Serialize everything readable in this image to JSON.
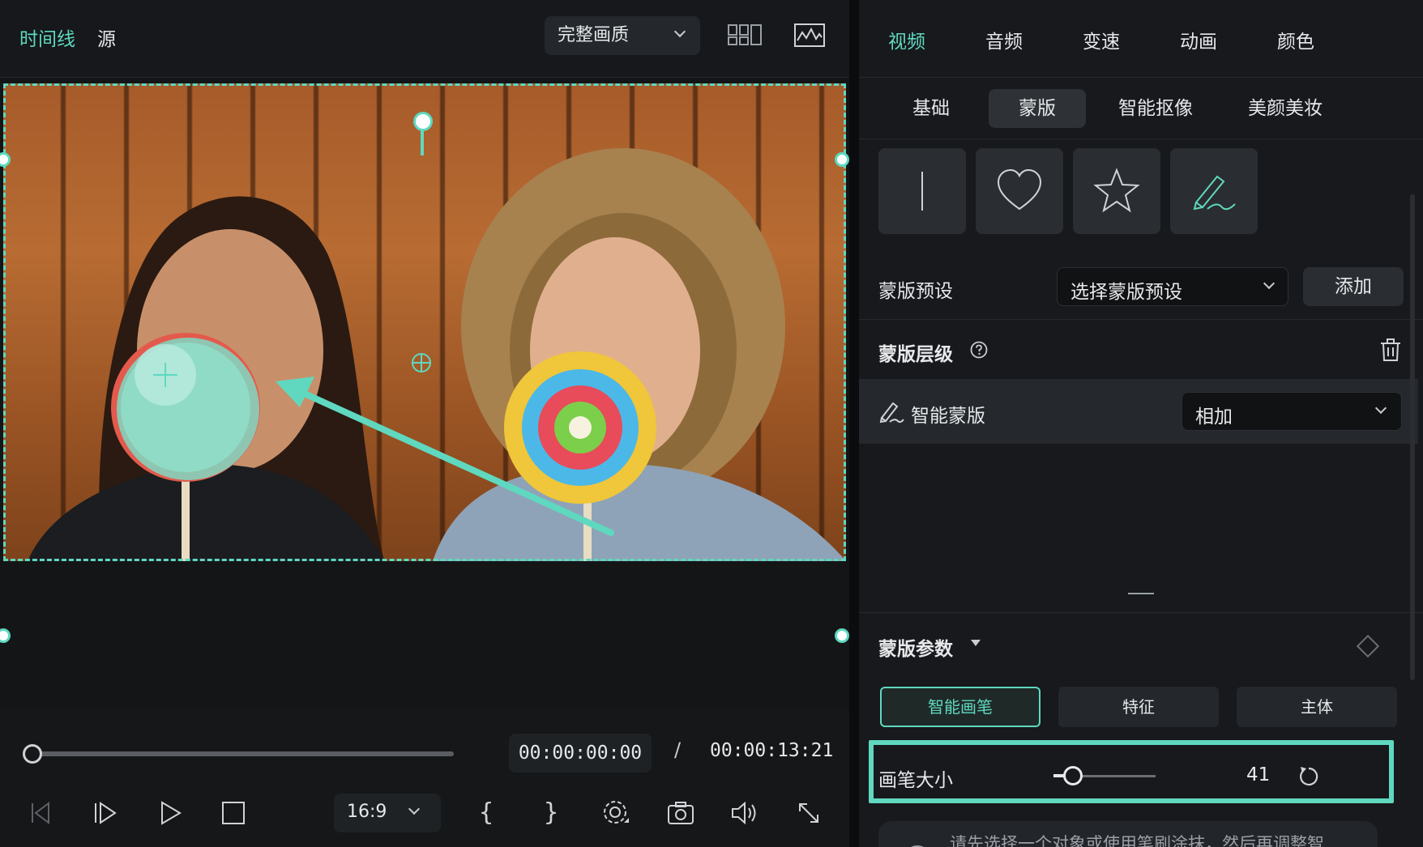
{
  "player": {
    "tabs": [
      {
        "label": "时间线",
        "active": true
      },
      {
        "label": "源",
        "active": false
      }
    ],
    "quality": {
      "label": "完整画质"
    },
    "current_time": "00:00:00:00",
    "separator": "/",
    "total_time": "00:00:13:21",
    "aspect_ratio": "16:9",
    "icons": [
      "grid-view-icon",
      "waveform-monitor-icon",
      "prev-frame-icon",
      "next-frame-icon",
      "play-icon",
      "stop-icon",
      "mark-in-icon",
      "mark-out-icon",
      "settings-icon",
      "snapshot-icon",
      "volume-icon",
      "fullscreen-icon"
    ]
  },
  "panel": {
    "top_tabs": [
      {
        "label": "视频",
        "active": true
      },
      {
        "label": "音频",
        "active": false
      },
      {
        "label": "变速",
        "active": false
      },
      {
        "label": "动画",
        "active": false
      },
      {
        "label": "颜色",
        "active": false
      }
    ],
    "sub_tabs": [
      {
        "label": "基础",
        "active": false
      },
      {
        "label": "蒙版",
        "active": true
      },
      {
        "label": "智能抠像",
        "active": false
      },
      {
        "label": "美颜美妆",
        "active": false
      }
    ],
    "mask_shapes": [
      "line-mask-icon",
      "heart-mask-icon",
      "star-mask-icon",
      "brush-mask-icon"
    ],
    "preset": {
      "label": "蒙版预设",
      "select_value": "选择蒙版预设",
      "add_label": "添加"
    },
    "layer": {
      "label": "蒙版层级",
      "item_label": "智能蒙版",
      "blend_value": "相加"
    },
    "params": {
      "label": "蒙版参数",
      "modes": [
        {
          "label": "智能画笔",
          "active": true
        },
        {
          "label": "特征",
          "active": false
        },
        {
          "label": "主体",
          "active": false
        }
      ],
      "brush_size_label": "画笔大小",
      "brush_size_value": "41",
      "brush_size": 41,
      "hint": "请先选择一个对象或使用笔刷涂抹，然后再调整智"
    }
  },
  "colors": {
    "accent": "#5fd8bf",
    "panel_bg": "#17191c",
    "player_bg": "#151719"
  }
}
